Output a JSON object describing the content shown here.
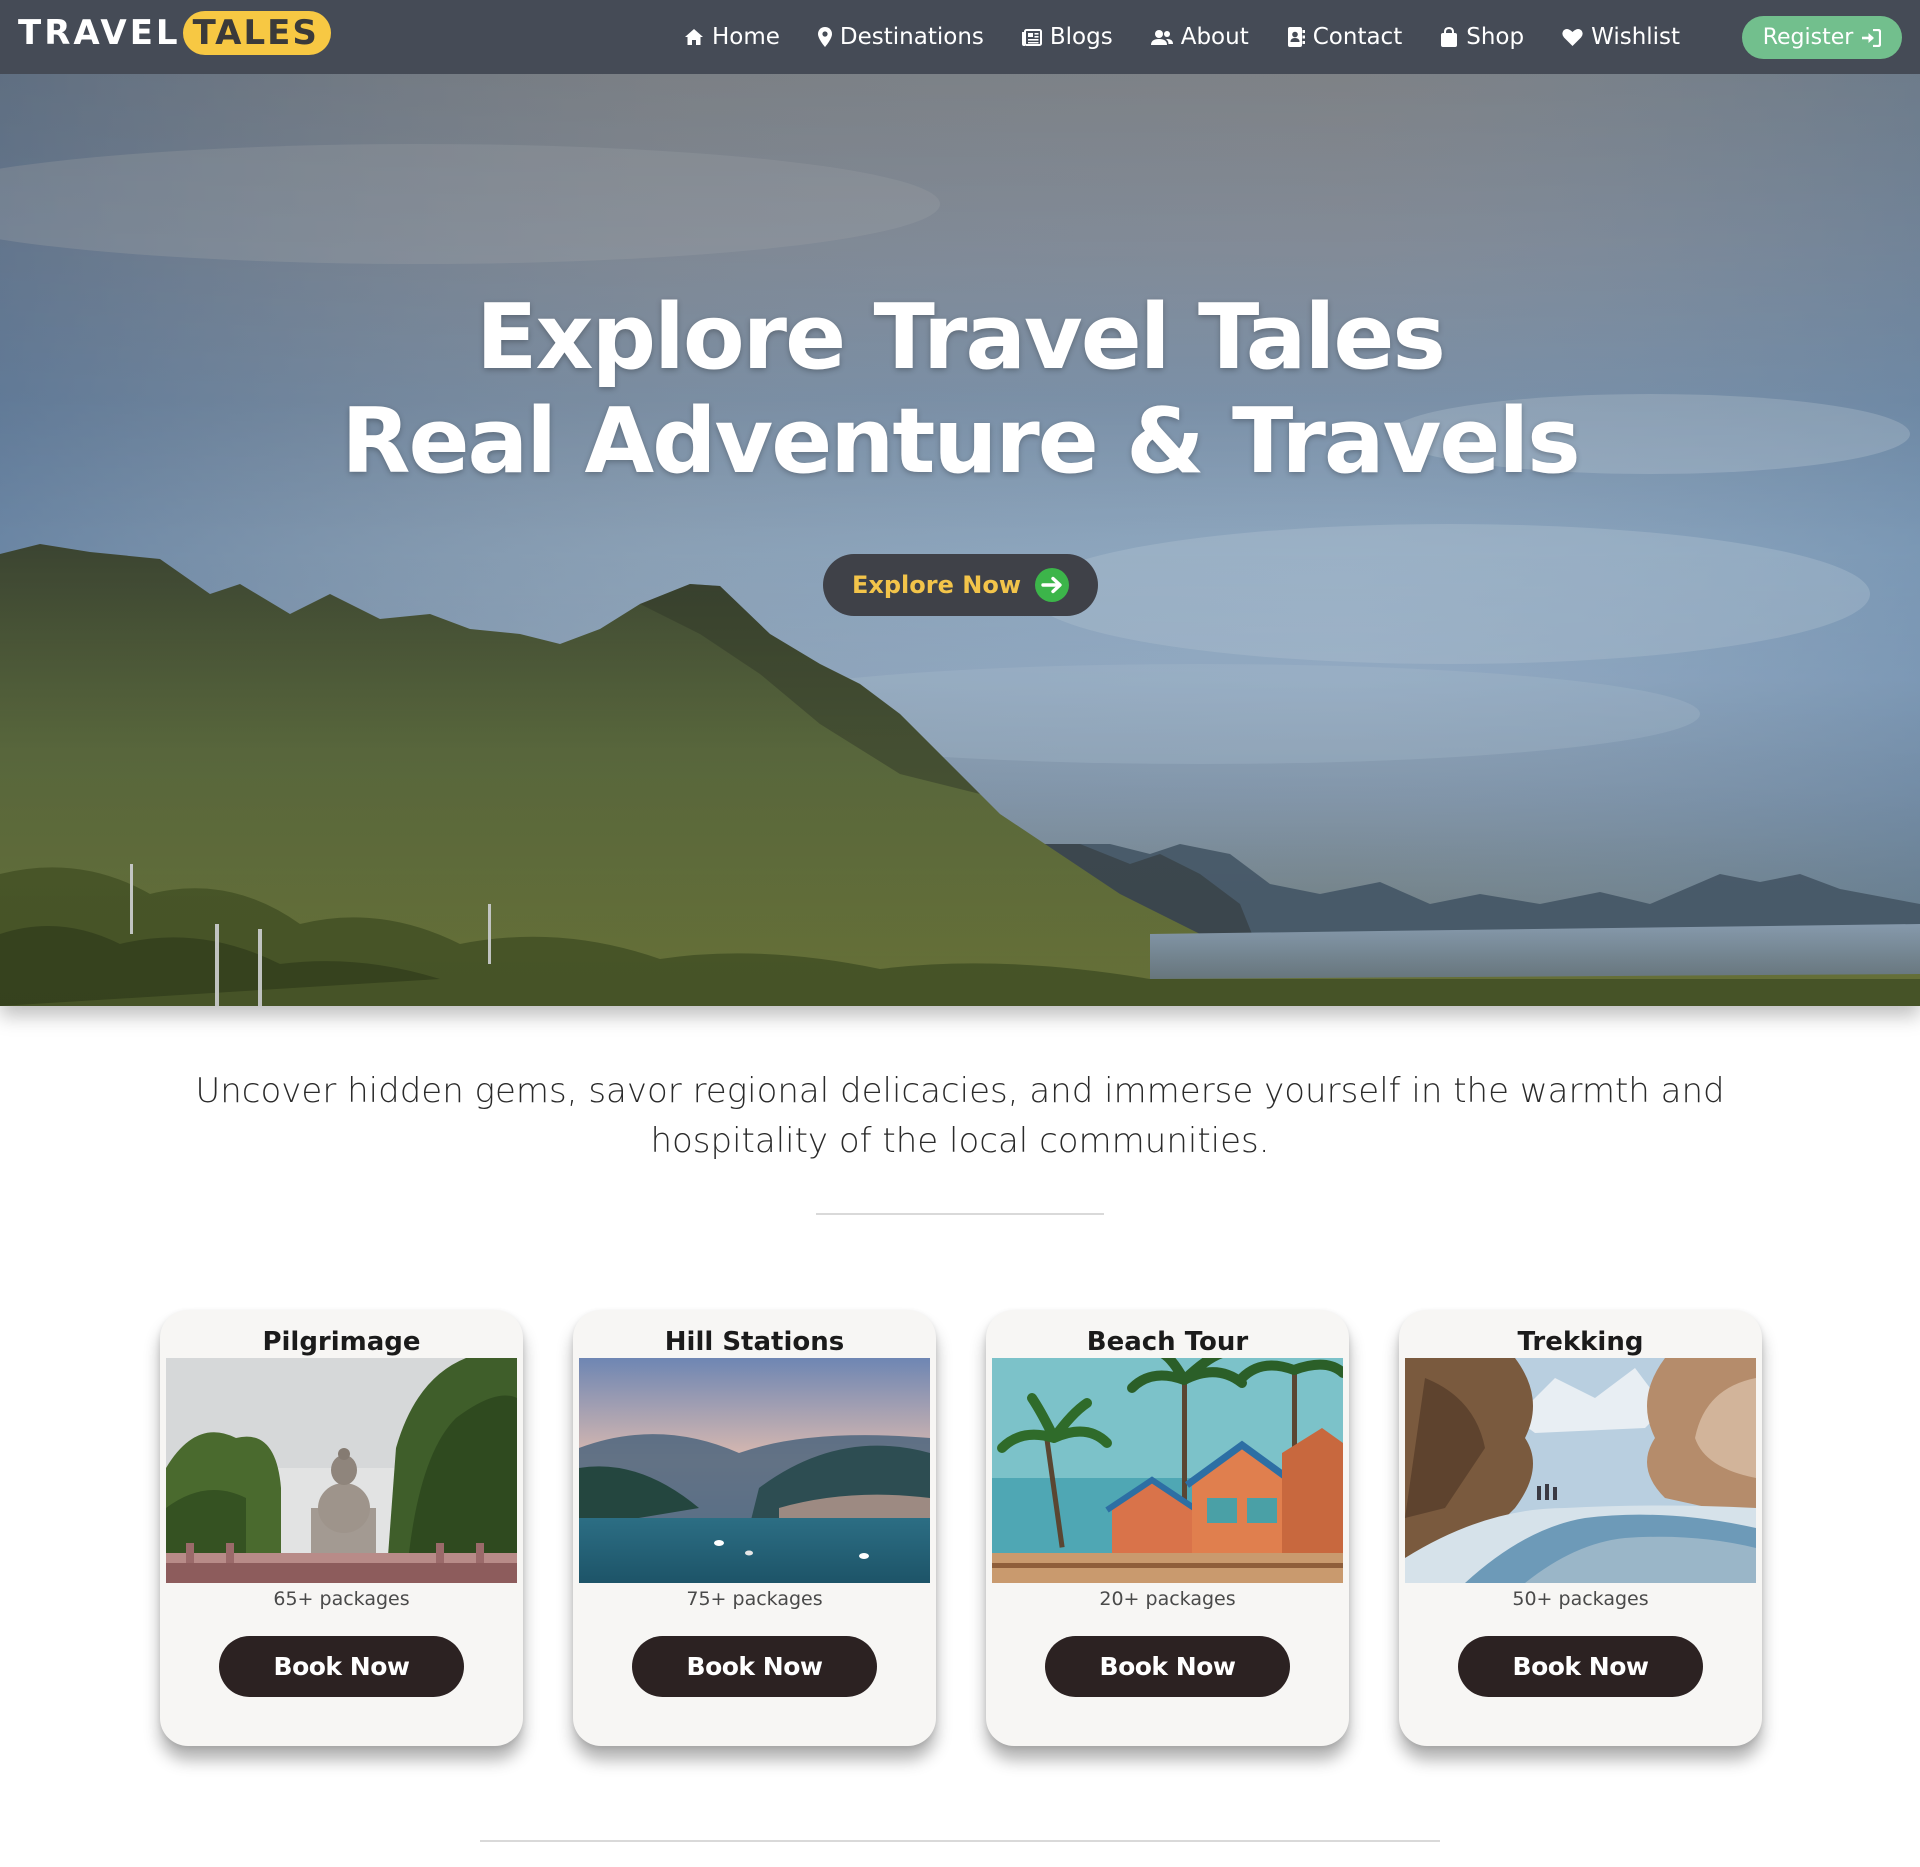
{
  "brand": {
    "part1": "TRAVEL",
    "part2": "TALES",
    "accent_color": "#f7c843"
  },
  "nav": {
    "items": [
      {
        "label": "Home",
        "icon": "home-icon"
      },
      {
        "label": "Destinations",
        "icon": "map-pin-icon"
      },
      {
        "label": "Blogs",
        "icon": "newspaper-icon"
      },
      {
        "label": "About",
        "icon": "users-icon"
      },
      {
        "label": "Contact",
        "icon": "contact-book-icon"
      },
      {
        "label": "Shop",
        "icon": "shopping-bag-icon"
      },
      {
        "label": "Wishlist",
        "icon": "heart-icon"
      }
    ],
    "register_label": "Register",
    "register_icon": "sign-in-icon",
    "background_color": "#454b56",
    "register_color": "#72bf8d"
  },
  "hero": {
    "title_line1": "Explore Travel Tales",
    "title_line2": "Real Adventure & Travels",
    "cta_label": "Explore Now",
    "cta_icon": "arrow-right-circle-icon",
    "cta_text_color": "#f3c44a",
    "cta_icon_color": "#3cb54a"
  },
  "intro": {
    "text": "Uncover hidden gems, savor regional delicacies, and immerse yourself in the warmth and hospitality of the local communities."
  },
  "categories": [
    {
      "title": "Pilgrimage",
      "packages": "65+ packages",
      "button": "Book Now"
    },
    {
      "title": "Hill Stations",
      "packages": "75+ packages",
      "button": "Book Now"
    },
    {
      "title": "Beach Tour",
      "packages": "20+ packages",
      "button": "Book Now"
    },
    {
      "title": "Trekking",
      "packages": "50+ packages",
      "button": "Book Now"
    }
  ]
}
